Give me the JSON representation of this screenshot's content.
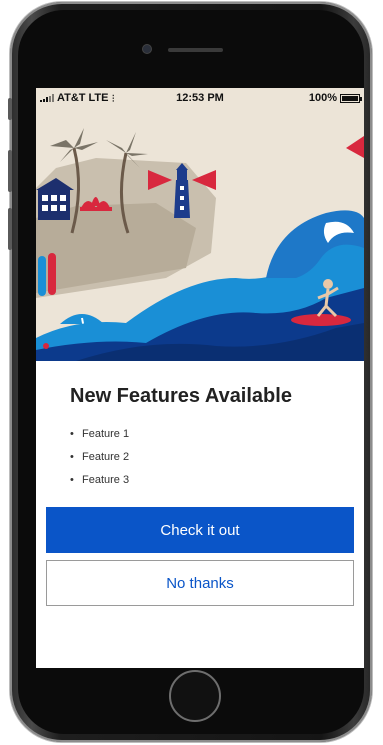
{
  "status_bar": {
    "carrier": "AT&T",
    "network": "LTE",
    "time": "12:53 PM",
    "battery": "100%"
  },
  "dialog": {
    "title": "New Features Available",
    "features": [
      "Feature 1",
      "Feature 2",
      "Feature 3"
    ],
    "primary_button": "Check it out",
    "secondary_button": "No thanks"
  },
  "colors": {
    "accent": "#0a55c8",
    "hero_sky": "#ece4d7",
    "wave_dark": "#0c3a8c",
    "wave_light": "#1a8fd6",
    "red": "#d8283e"
  },
  "icons": {
    "signal": "signal-bars-icon",
    "activity": "activity-spinner-icon",
    "battery": "battery-icon",
    "camera": "camera-icon",
    "home": "home-button-icon"
  }
}
